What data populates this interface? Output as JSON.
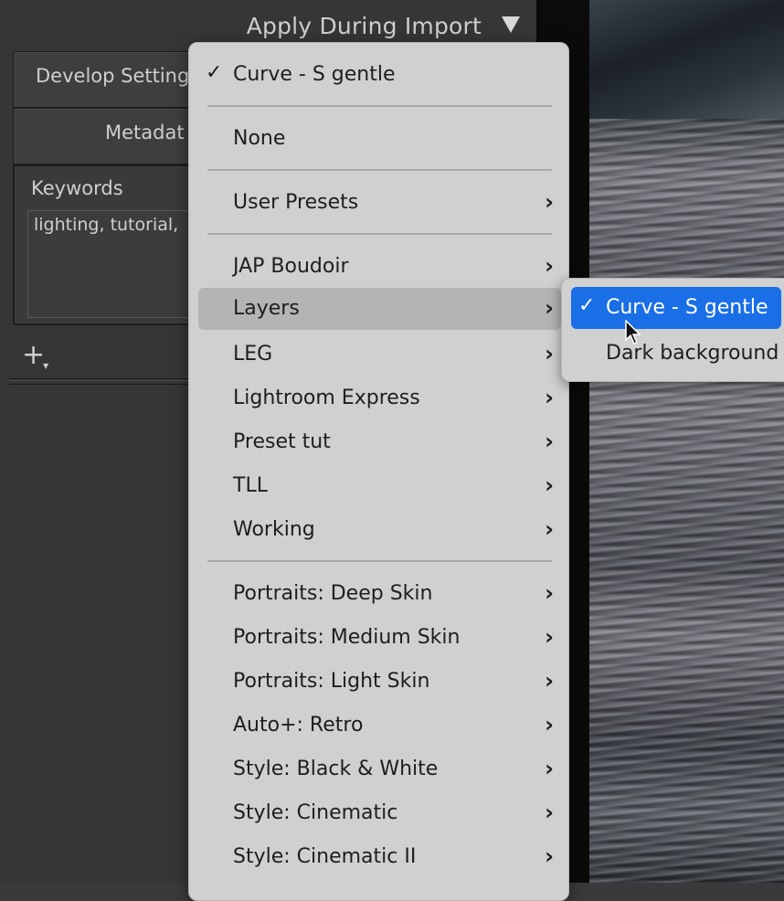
{
  "panel": {
    "title": "Apply During Import",
    "develop_settings_label": "Develop Setting",
    "metadata_label": "Metadat",
    "keywords_label": "Keywords",
    "keywords_value": "lighting, tutorial,",
    "add_button": "+"
  },
  "menu": {
    "selected_item": "Curve - S gentle",
    "none": "None",
    "user_presets": "User Presets",
    "groups": [
      "JAP Boudoir",
      "Layers",
      "LEG",
      "Lightroom Express",
      "Preset tut",
      "TLL",
      "Working"
    ],
    "adaptive": [
      "Portraits: Deep Skin",
      "Portraits: Medium Skin",
      "Portraits: Light Skin",
      "Auto+: Retro",
      "Style: Black & White",
      "Style: Cinematic",
      "Style: Cinematic II"
    ]
  },
  "submenu": {
    "items": [
      "Curve - S gentle",
      "Dark background"
    ],
    "selected": "Curve - S gentle"
  },
  "icons": {
    "check": "checkmark-icon",
    "chevron": "chevron-right-icon",
    "dropdown": "triangle-down-icon",
    "cursor": "mouse-pointer-icon"
  },
  "colors": {
    "highlight": "#1a6ee6",
    "menu_bg": "#d0d0d0",
    "panel_bg": "#363636"
  }
}
